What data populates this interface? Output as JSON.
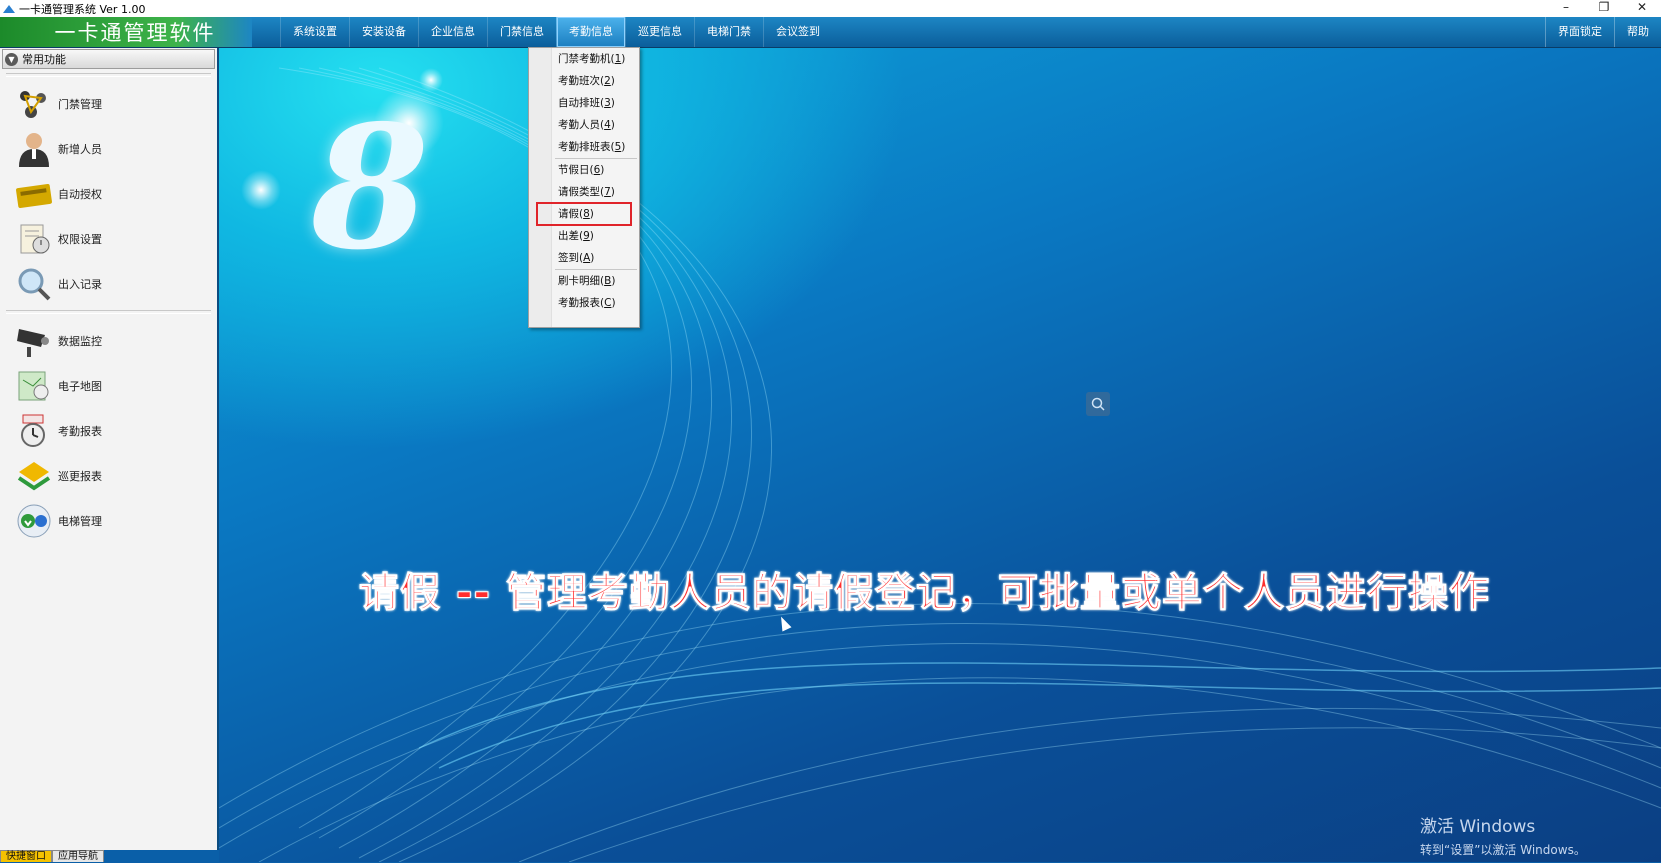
{
  "window": {
    "title": "一卡通管理系统 Ver 1.00",
    "buttons": [
      "–",
      "❐",
      "✕"
    ]
  },
  "menubar": {
    "brand": "一卡通管理软件",
    "items": [
      "系统设置",
      "安装设备",
      "企业信息",
      "门禁信息",
      "考勤信息",
      "巡更信息",
      "电梯门禁",
      "会议签到"
    ],
    "active_item": "考勤信息",
    "right_items": [
      "界面锁定",
      "帮助"
    ]
  },
  "sidebar": {
    "header": "常用功能",
    "group1": [
      {
        "label": "门禁管理",
        "icon": "access-control-icon"
      },
      {
        "label": "新增人员",
        "icon": "person-icon"
      },
      {
        "label": "自动授权",
        "icon": "card-icon"
      },
      {
        "label": "权限设置",
        "icon": "permission-icon"
      },
      {
        "label": "出入记录",
        "icon": "magnifier-icon"
      }
    ],
    "group2": [
      {
        "label": "数据监控",
        "icon": "camera-icon"
      },
      {
        "label": "电子地图",
        "icon": "map-icon"
      },
      {
        "label": "考勤报表",
        "icon": "clock-icon"
      },
      {
        "label": "巡更报表",
        "icon": "patrol-icon"
      },
      {
        "label": "电梯管理",
        "icon": "elevator-icon"
      }
    ],
    "tabs": [
      "快捷窗口",
      "应用导航"
    ]
  },
  "dropdown": {
    "items": [
      {
        "label": "门禁考勤机",
        "key": "1"
      },
      {
        "label": "考勤班次",
        "key": "2"
      },
      {
        "label": "自动排班",
        "key": "3"
      },
      {
        "label": "考勤人员",
        "key": "4"
      },
      {
        "label": "考勤排班表",
        "key": "5"
      },
      {
        "label": "节假日",
        "key": "6"
      },
      {
        "label": "请假类型",
        "key": "7"
      },
      {
        "label": "请假",
        "key": "8"
      },
      {
        "label": "出差",
        "key": "9"
      },
      {
        "label": "签到",
        "key": "A"
      },
      {
        "label": "刷卡明细",
        "key": "B"
      },
      {
        "label": "考勤报表",
        "key": "C"
      }
    ],
    "highlighted": "请假"
  },
  "main": {
    "logo_glyph": "8",
    "caption": "请假 -- 管理考勤人员的请假登记，可批量或单个人员进行操作",
    "watermark_line1": "激活 Windows",
    "watermark_line2": "转到“设置”以激活 Windows。"
  },
  "colors": {
    "menubar": "#0b5e9b",
    "brand_green": "#3eb34a",
    "caption_red": "#ff2e2e",
    "highlight_box": "#e0242a"
  }
}
